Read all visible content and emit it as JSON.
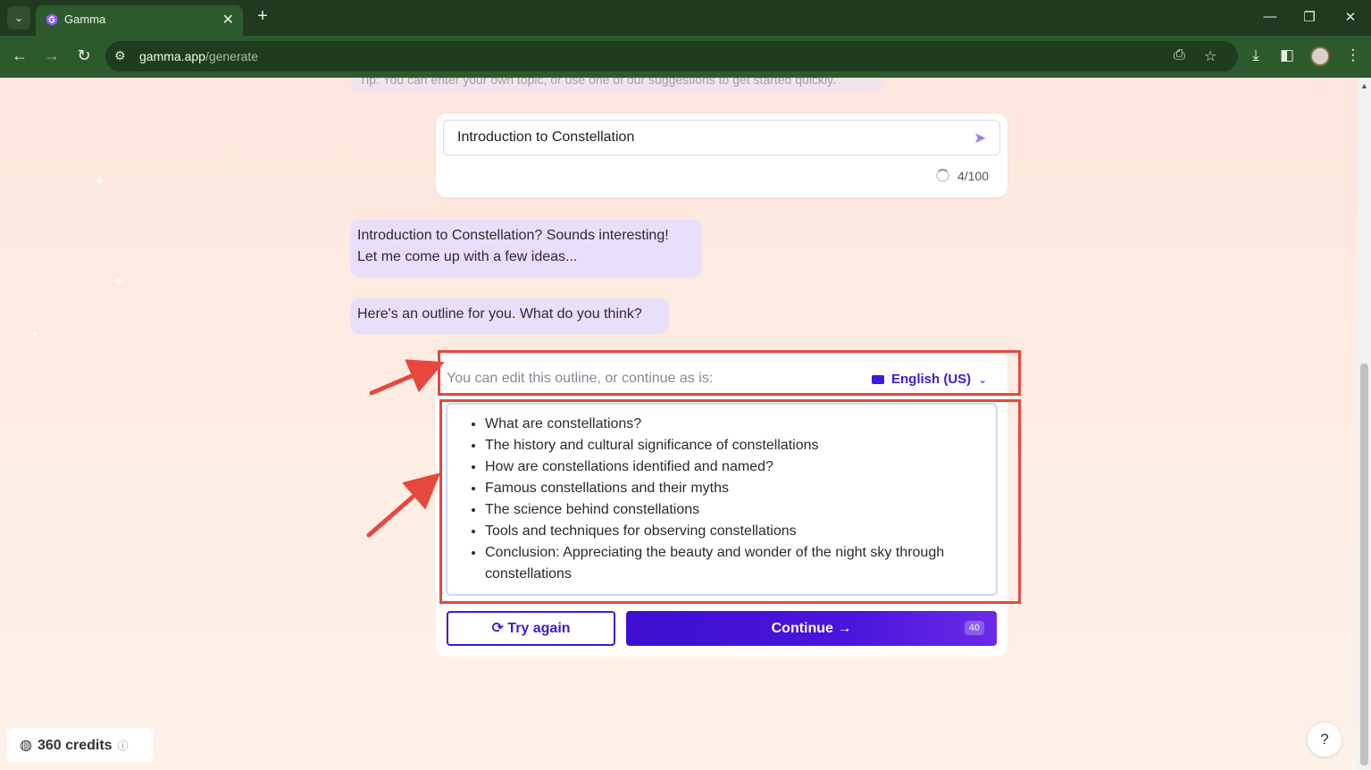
{
  "browser": {
    "tab_title": "Gamma",
    "url_host": "gamma.app",
    "url_path": "/generate",
    "new_tab": "+",
    "tab_close": "✕",
    "minimize": "—",
    "restore": "❐",
    "close": "✕"
  },
  "tip": {
    "text": "Tip: You can enter your own topic, or use one of our suggestions to get started quickly."
  },
  "topic": {
    "value": "Introduction to Constellation",
    "counter": "4/100"
  },
  "chat": {
    "bubble_1_line_1": "Introduction to Constellation? Sounds interesting!",
    "bubble_1_line_2": "Let me come up with a few ideas...",
    "bubble_2": "Here's an outline for you. What do you think?"
  },
  "outline": {
    "header": "You can edit this outline, or continue as is:",
    "language": "English (US)",
    "items": [
      "What are constellations?",
      "The history and cultural significance of constellations",
      "How are constellations identified and named?",
      "Famous constellations and their myths",
      "The science behind constellations",
      "Tools and techniques for observing constellations",
      "Conclusion: Appreciating the beauty and wonder of the night sky through constellations"
    ]
  },
  "actions": {
    "try_again": "Try again",
    "continue": "Continue",
    "cost": "40"
  },
  "footer": {
    "credits": "360 credits",
    "help": "?"
  },
  "colors": {
    "accent": "#3d1bd4",
    "highlight": "#e8473d",
    "chrome": "#2d5a2d"
  }
}
